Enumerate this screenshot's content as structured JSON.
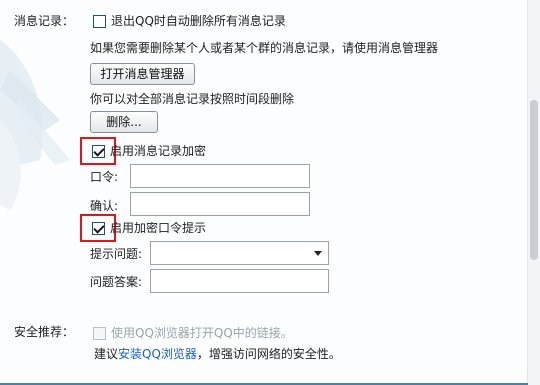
{
  "history_section": {
    "label": "消息记录：",
    "auto_delete_checkbox_label": "退出QQ时自动删除所有消息记录",
    "manager_hint": "如果您需要删除某个人或者某个群的消息记录，请使用消息管理器",
    "open_manager_button": "打开消息管理器",
    "delete_hint": "你可以对全部消息记录按照时间段删除",
    "delete_button": "删除...",
    "encrypt_checkbox_label": "启用消息记录加密",
    "password_label": "口令:",
    "password_value": "",
    "confirm_label": "确认:",
    "confirm_value": "",
    "hint_checkbox_label": "启用加密口令提示",
    "question_label": "提示问题:",
    "question_selected": "",
    "answer_label": "问题答案:",
    "answer_value": ""
  },
  "security_section": {
    "label": "安全推荐：",
    "browser_checkbox_label": "使用QQ浏览器打开QQ中的链接。",
    "advice_prefix": "建议",
    "advice_link": "安装QQ浏览器",
    "advice_suffix": "，增强访问网络的安全性。"
  },
  "colors": {
    "highlight_box": "#e0161b",
    "link": "#1b61c4",
    "bottom_border": "#4b7fae"
  }
}
